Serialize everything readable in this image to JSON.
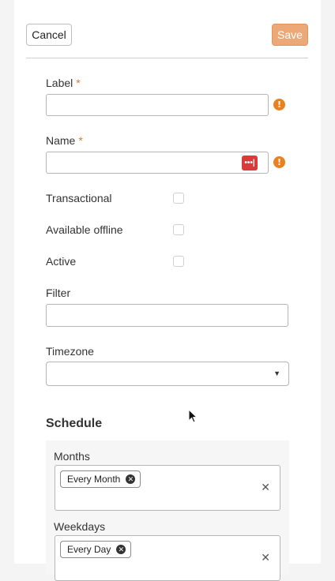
{
  "toolbar": {
    "cancel_label": "Cancel",
    "save_label": "Save"
  },
  "form": {
    "label": {
      "text": "Label",
      "required_mark": "*",
      "value": ""
    },
    "name": {
      "text": "Name",
      "required_mark": "*",
      "value": ""
    },
    "transactional": {
      "text": "Transactional",
      "checked": false
    },
    "available_offline": {
      "text": "Available offline",
      "checked": false
    },
    "active": {
      "text": "Active",
      "checked": false
    },
    "filter": {
      "text": "Filter",
      "value": ""
    },
    "timezone": {
      "text": "Timezone",
      "selected": ""
    }
  },
  "schedule": {
    "title": "Schedule",
    "months": {
      "label": "Months",
      "tags": [
        "Every Month"
      ]
    },
    "weekdays": {
      "label": "Weekdays",
      "tags": [
        "Every Day"
      ]
    }
  },
  "icons": {
    "warning": "warning-icon",
    "password_manager": "password-manager-icon",
    "caret": "chevron-down-icon",
    "tag_remove": "remove-tag-icon",
    "clear": "clear-icon"
  },
  "colors": {
    "accent": "#eda877",
    "warning": "#e88120",
    "required": "#e07b2c",
    "password_icon": "#d93b3b"
  }
}
